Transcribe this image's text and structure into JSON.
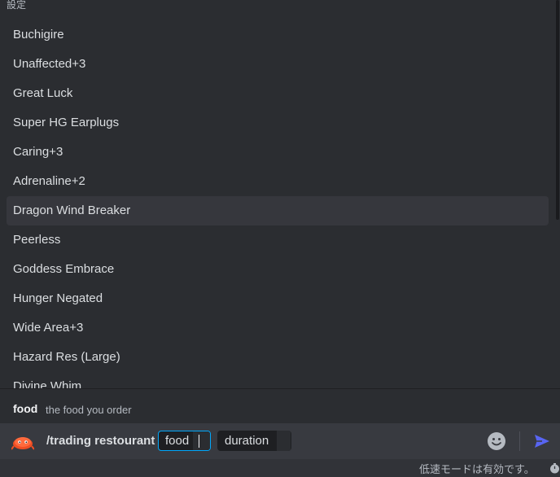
{
  "popup": {
    "header": "設定",
    "options": [
      {
        "label": "Buchigire"
      },
      {
        "label": "Unaffected+3"
      },
      {
        "label": "Great Luck"
      },
      {
        "label": "Super HG Earplugs"
      },
      {
        "label": "Caring+3"
      },
      {
        "label": "Adrenaline+2"
      },
      {
        "label": "Dragon Wind Breaker",
        "selected": true
      },
      {
        "label": "Peerless"
      },
      {
        "label": "Goddess Embrace"
      },
      {
        "label": "Hunger Negated"
      },
      {
        "label": "Wide Area+3"
      },
      {
        "label": "Hazard Res (Large)"
      },
      {
        "label": "Divine Whim"
      }
    ]
  },
  "param": {
    "name": "food",
    "description": "the food you order"
  },
  "composer": {
    "bot_avatar_icon": "bot-avatar-icon",
    "command": "/trading restourant",
    "options": [
      {
        "label": "food",
        "value": ""
      },
      {
        "label": "duration",
        "value": ""
      }
    ],
    "emoji_icon": "emoji-icon",
    "send_icon": "send-icon"
  },
  "footer": {
    "slowmode_text": "低速モードは有効です。",
    "timer_icon": "timer-icon"
  },
  "colors": {
    "background": "#313338",
    "popup": "#2b2d31",
    "input_bar": "#383a40",
    "selected_row": "#36373d",
    "active_chip_border": "#00a8fc",
    "send": "#5865f2",
    "bot_avatar": "#f04e23"
  }
}
